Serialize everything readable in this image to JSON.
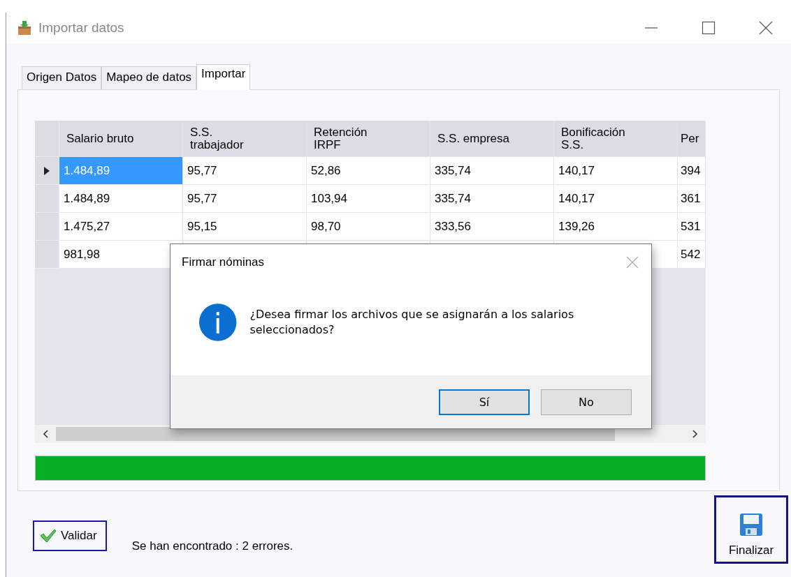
{
  "window": {
    "title": "Importar datos"
  },
  "tabs": [
    {
      "label": "Origen Datos",
      "selected": false
    },
    {
      "label": "Mapeo de datos",
      "selected": false
    },
    {
      "label": "Importar",
      "selected": true
    }
  ],
  "table": {
    "columns": [
      "Salario bruto",
      "S.S.\ntrabajador",
      "Retención\nIRPF",
      "S.S. empresa",
      "Bonificación\nS.S.",
      "Per"
    ],
    "rows": [
      {
        "selected": true,
        "cells": [
          "1.484,89",
          "95,77",
          "52,86",
          "335,74",
          "140,17",
          "394"
        ]
      },
      {
        "selected": false,
        "cells": [
          "1.484,89",
          "95,77",
          "103,94",
          "335,74",
          "140,17",
          "361"
        ]
      },
      {
        "selected": false,
        "cells": [
          "1.475,27",
          "95,15",
          "98,70",
          "333,56",
          "139,26",
          "531"
        ]
      },
      {
        "selected": false,
        "cells": [
          "981,98",
          null,
          null,
          null,
          null,
          "542"
        ]
      }
    ]
  },
  "progress": {
    "level": 1
  },
  "validate_button": "Validar",
  "status": "Se han encontrado : 2 errores.",
  "finish_button": "Finalizar",
  "dialog": {
    "title": "Firmar nóminas",
    "message": "¿Desea firmar los archivos que se asignarán a los salarios seleccionados?",
    "buttons": [
      {
        "label": "Sí",
        "selected": true
      },
      {
        "label": "No",
        "selected": false
      }
    ]
  }
}
